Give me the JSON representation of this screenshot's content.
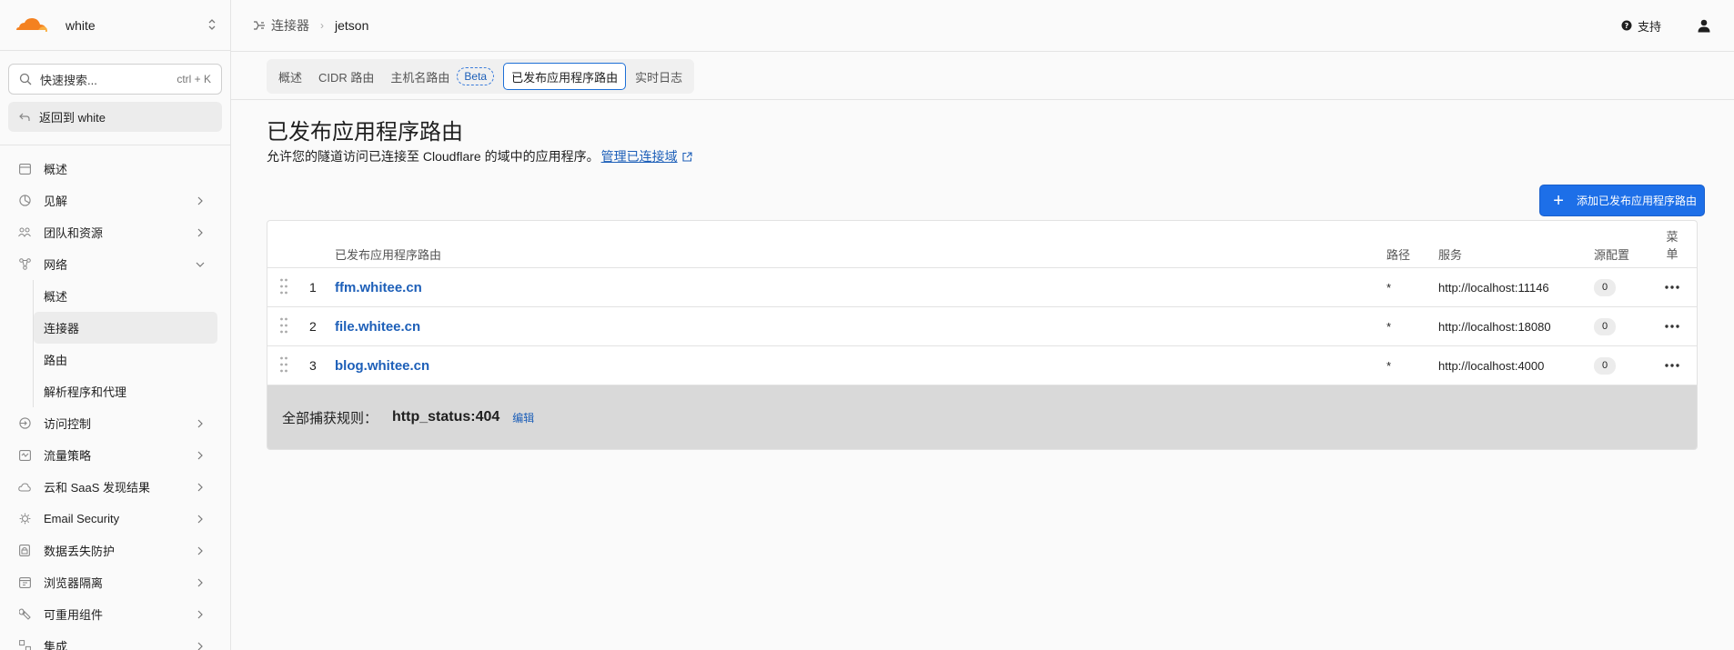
{
  "colors": {
    "accent": "#1d6fe8",
    "link": "#1d5fb8",
    "logo_orange": "#f48120",
    "logo_light": "#faad3f"
  },
  "sidebar": {
    "account_name": "white",
    "search": {
      "label": "快速搜索...",
      "shortcut": "ctrl + K",
      "icon": "search-icon"
    },
    "back_label": "返回到 white",
    "nav": [
      {
        "label": "概述",
        "icon": "overview-icon",
        "chevron": false
      },
      {
        "label": "见解",
        "icon": "insights-icon",
        "chevron": true
      },
      {
        "label": "团队和资源",
        "icon": "team-icon",
        "chevron": true
      },
      {
        "label": "网络",
        "icon": "network-icon",
        "chevron": true,
        "expanded": true
      }
    ],
    "network_sub": [
      {
        "label": "概述",
        "active": false
      },
      {
        "label": "连接器",
        "active": true
      },
      {
        "label": "路由",
        "active": false
      },
      {
        "label": "解析程序和代理",
        "active": false
      }
    ],
    "nav_after": [
      {
        "label": "访问控制",
        "icon": "access-icon",
        "chevron": true
      },
      {
        "label": "流量策略",
        "icon": "traffic-icon",
        "chevron": true
      },
      {
        "label": "云和 SaaS 发现结果",
        "icon": "cloud-icon",
        "chevron": true
      },
      {
        "label": "Email Security",
        "icon": "email-icon",
        "chevron": true
      },
      {
        "label": "数据丢失防护",
        "icon": "dlp-icon",
        "chevron": true
      },
      {
        "label": "浏览器隔离",
        "icon": "browser-icon",
        "chevron": true
      },
      {
        "label": "可重用组件",
        "icon": "components-icon",
        "chevron": true
      },
      {
        "label": "集成",
        "icon": "integrations-icon",
        "chevron": true
      }
    ]
  },
  "topbar": {
    "breadcrumb": {
      "parent": "连接器",
      "current": "jetson"
    },
    "support_label": "支持"
  },
  "tabs": [
    {
      "label": "概述",
      "active": false
    },
    {
      "label": "CIDR 路由",
      "active": false
    },
    {
      "label": "主机名路由",
      "active": false,
      "badge": "Beta"
    },
    {
      "label": "已发布应用程序路由",
      "active": true
    },
    {
      "label": "实时日志",
      "active": false
    }
  ],
  "page": {
    "title": "已发布应用程序路由",
    "description": "允许您的隧道访问已连接至 Cloudflare 的域中的应用程序。",
    "manage_link": "管理已连接域",
    "add_button": "添加已发布应用程序路由"
  },
  "table": {
    "headers": {
      "hostname": "已发布应用程序路由",
      "path": "路径",
      "service": "服务",
      "origin": "源配置",
      "menu": "菜单"
    },
    "rows": [
      {
        "index": "1",
        "hostname": "ffm.whitee.cn",
        "path": "*",
        "service": "http://localhost:11146",
        "origin_count": "0"
      },
      {
        "index": "2",
        "hostname": "file.whitee.cn",
        "path": "*",
        "service": "http://localhost:18080",
        "origin_count": "0"
      },
      {
        "index": "3",
        "hostname": "blog.whitee.cn",
        "path": "*",
        "service": "http://localhost:4000",
        "origin_count": "0"
      }
    ],
    "catch_all": {
      "label": "全部捕获规则：",
      "value": "http_status:404",
      "edit": "编辑"
    }
  }
}
